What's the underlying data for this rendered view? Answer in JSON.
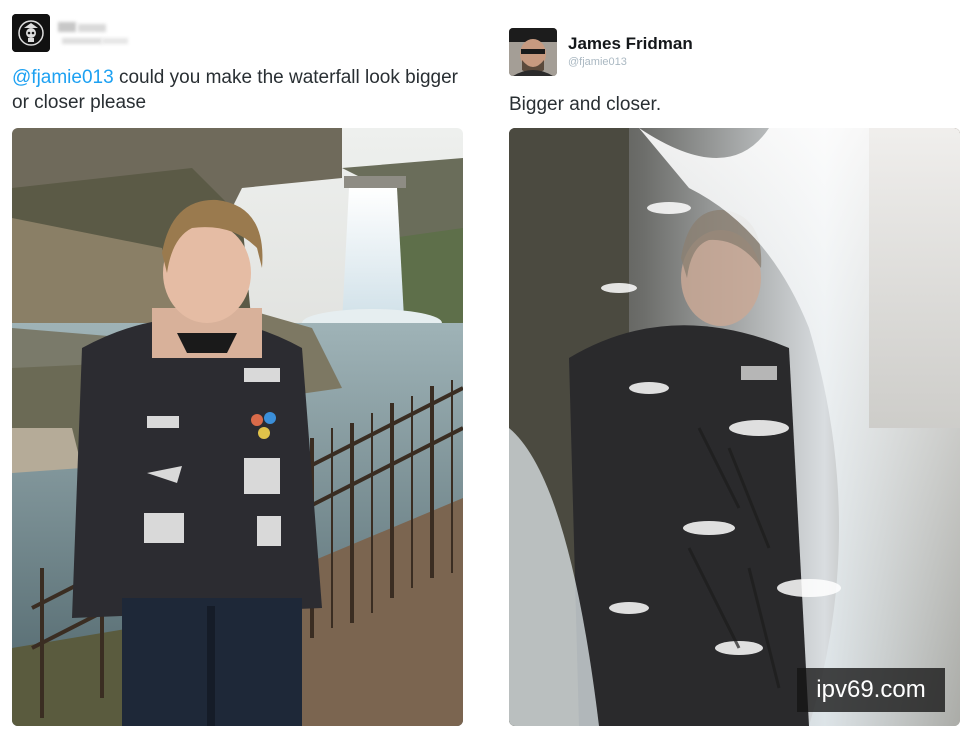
{
  "left_tweet": {
    "text_mention": "@fjamie013",
    "text_body": " could you make the waterfall look bigger or closer please"
  },
  "right_tweet": {
    "author_name": "James Fridman",
    "author_handle": "@fjamie013",
    "text": "Bigger and closer."
  },
  "watermark": "ipv69.com",
  "colors": {
    "mention": "#1da1f2",
    "text": "#292f33",
    "handle": "#aab8c2"
  }
}
